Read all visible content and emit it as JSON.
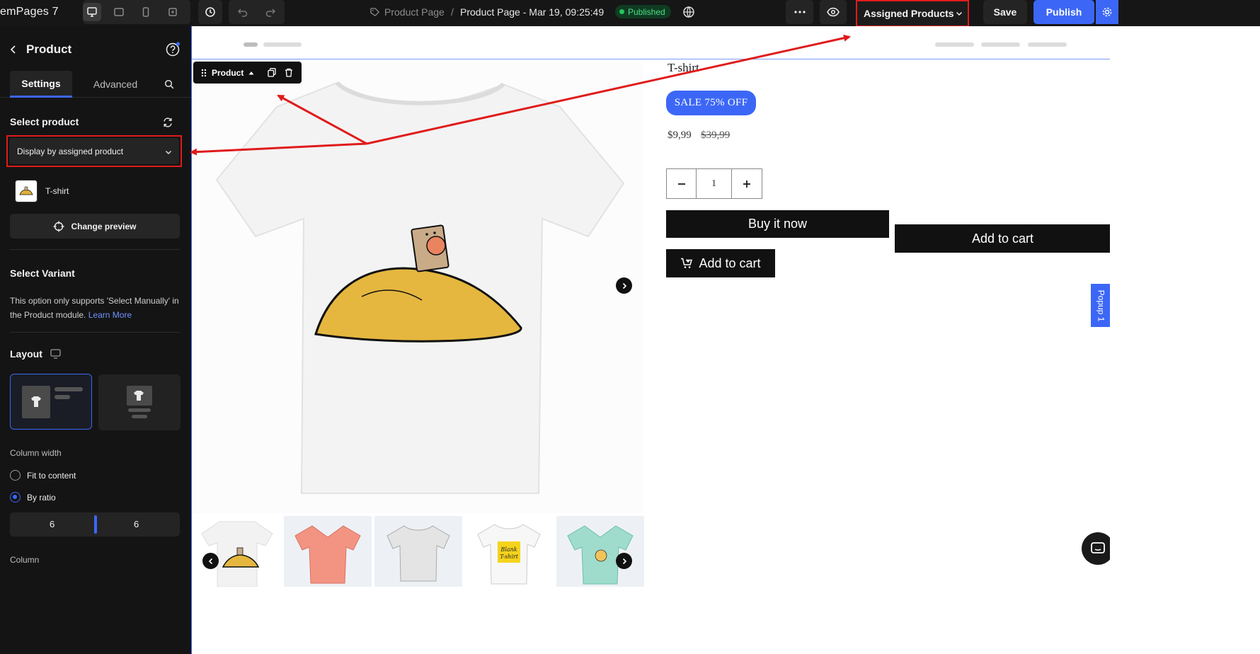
{
  "topbar": {
    "brand": "emPages 7",
    "breadcrumb_parent": "Product Page",
    "breadcrumb_sep": "/",
    "breadcrumb_current": "Product Page - Mar 19, 09:25:49",
    "status_badge": "Published",
    "assigned_label": "Assigned Products",
    "save_label": "Save",
    "publish_label": "Publish"
  },
  "sidebar": {
    "title": "Product",
    "tabs": [
      "Settings",
      "Advanced"
    ],
    "select_product_title": "Select product",
    "select_value": "Display by assigned product",
    "product_name": "T-shirt",
    "change_preview": "Change preview",
    "select_variant_title": "Select Variant",
    "variant_help": "This option only supports 'Select Manually' in the Product module.",
    "learn_more": "Learn More",
    "layout_title": "Layout",
    "column_width_label": "Column width",
    "radio_fit": "Fit to content",
    "radio_ratio": "By ratio",
    "ratio_left": "6",
    "ratio_right": "6",
    "column_label": "Column"
  },
  "canvas": {
    "toolbar_label": "Product",
    "product_title": "T-shirt",
    "sale_badge": "SALE 75% OFF",
    "price": "$9,99",
    "compare_price": "$39,99",
    "quantity": "1",
    "buy_now": "Buy it now",
    "add_to_cart": "Add to cart",
    "add_to_cart_right": "Add to cart",
    "popup_tab": "Popup 1"
  },
  "colors": {
    "accent": "#3c67f6",
    "annotation": "#e01b1b",
    "published": "#22c55e"
  }
}
